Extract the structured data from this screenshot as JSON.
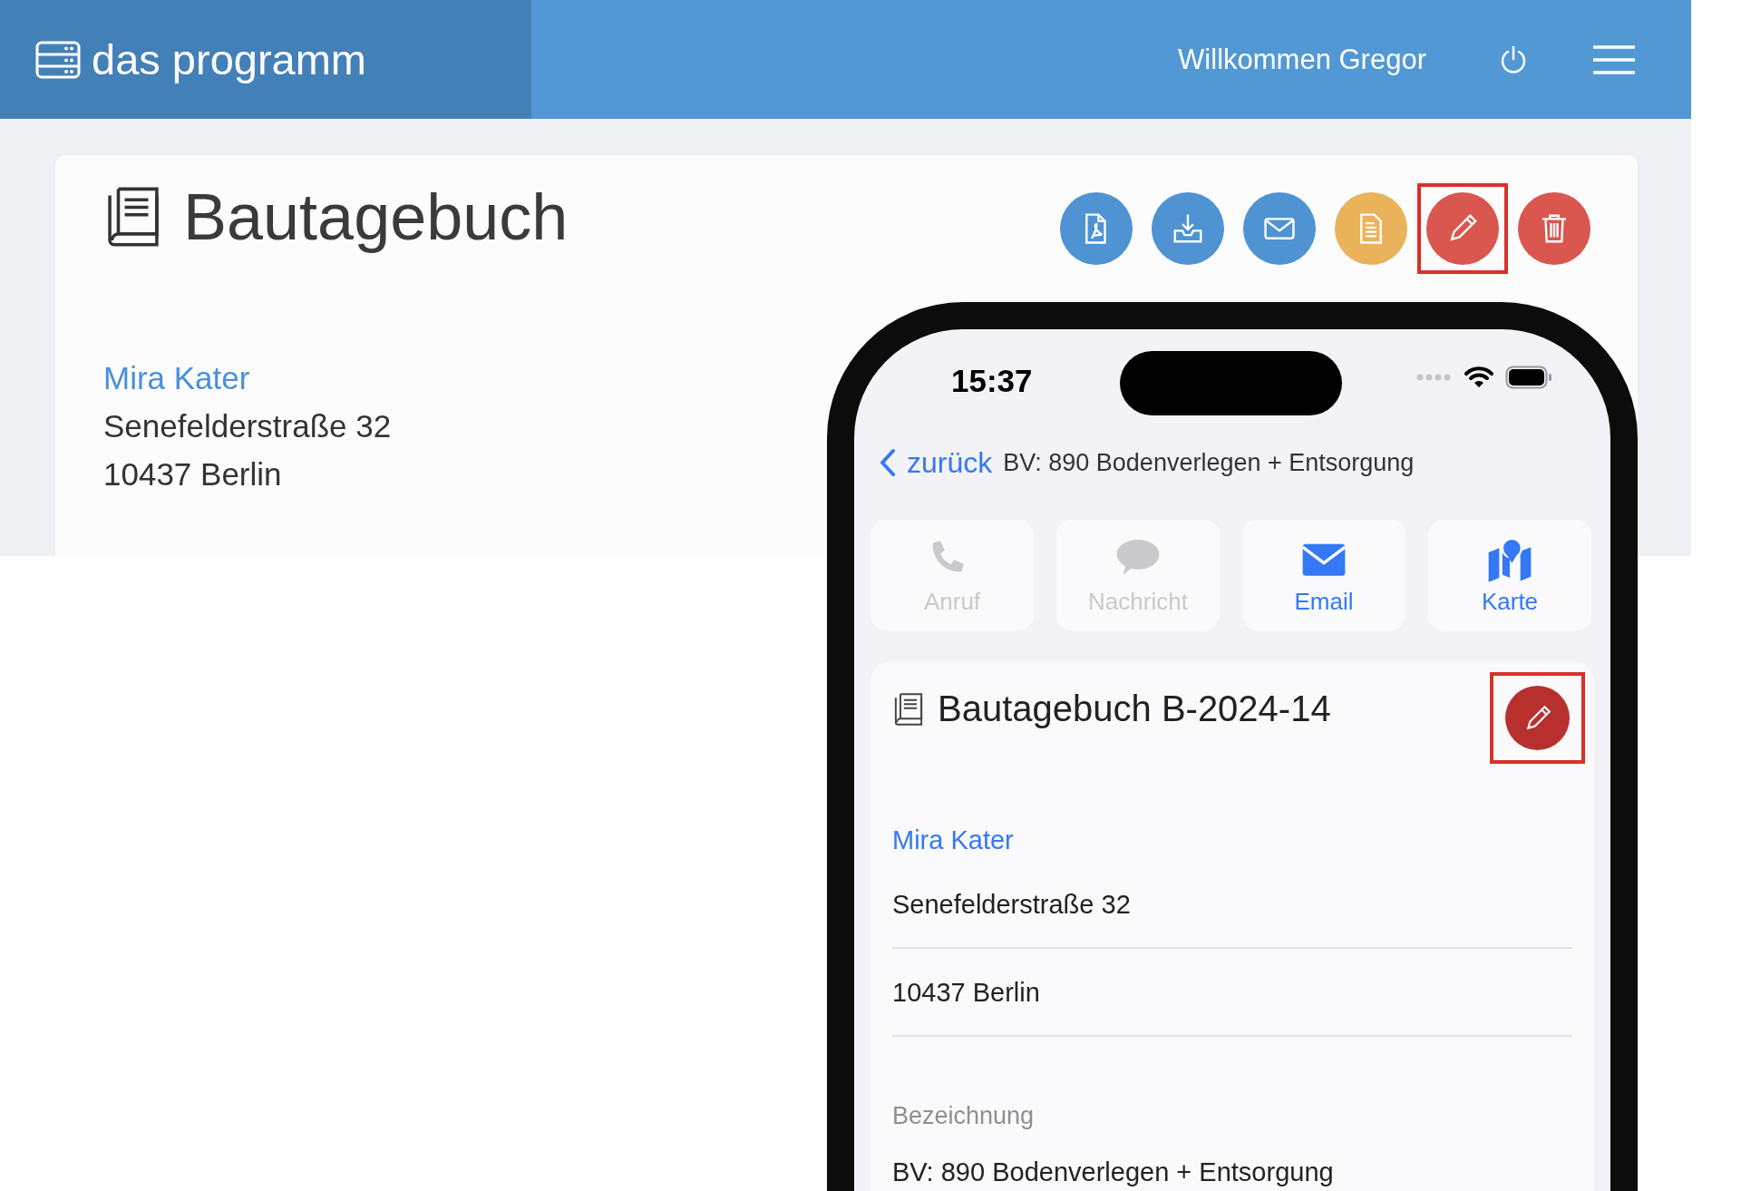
{
  "header": {
    "app_name": "das programm",
    "welcome": "Willkommen Gregor"
  },
  "page": {
    "title": "Bautagebuch",
    "actions": [
      {
        "kind": "pdf",
        "color": "#4f93d2",
        "highlighted": false
      },
      {
        "kind": "download",
        "color": "#4f93d2",
        "highlighted": false
      },
      {
        "kind": "mail",
        "color": "#4f93d2",
        "highlighted": false
      },
      {
        "kind": "document",
        "color": "#eab25a",
        "highlighted": false
      },
      {
        "kind": "edit",
        "color": "#d9574e",
        "highlighted": true
      },
      {
        "kind": "trash",
        "color": "#d9574e",
        "highlighted": false
      }
    ],
    "contact": {
      "name": "Mira Kater",
      "street": "Senefelderstraße 32",
      "city": "10437 Berlin"
    }
  },
  "phone": {
    "time": "15:37",
    "back": "zurück",
    "nav_title": "BV: 890 Bodenverlegen + Entsorgung",
    "quick_actions": [
      {
        "kind": "phone",
        "label": "Anruf",
        "disabled": true
      },
      {
        "kind": "message",
        "label": "Nachricht",
        "disabled": true
      },
      {
        "kind": "mail",
        "label": "Email",
        "disabled": false
      },
      {
        "kind": "map",
        "label": "Karte",
        "disabled": false
      }
    ],
    "card": {
      "title": "Bautagebuch B-2024-14",
      "edit_highlighted": true,
      "name": "Mira Kater",
      "street": "Senefelderstraße 32",
      "city": "10437 Berlin",
      "field_label": "Bezeichnung",
      "field_value": "BV: 890 Bodenverlegen + Entsorgung"
    }
  }
}
